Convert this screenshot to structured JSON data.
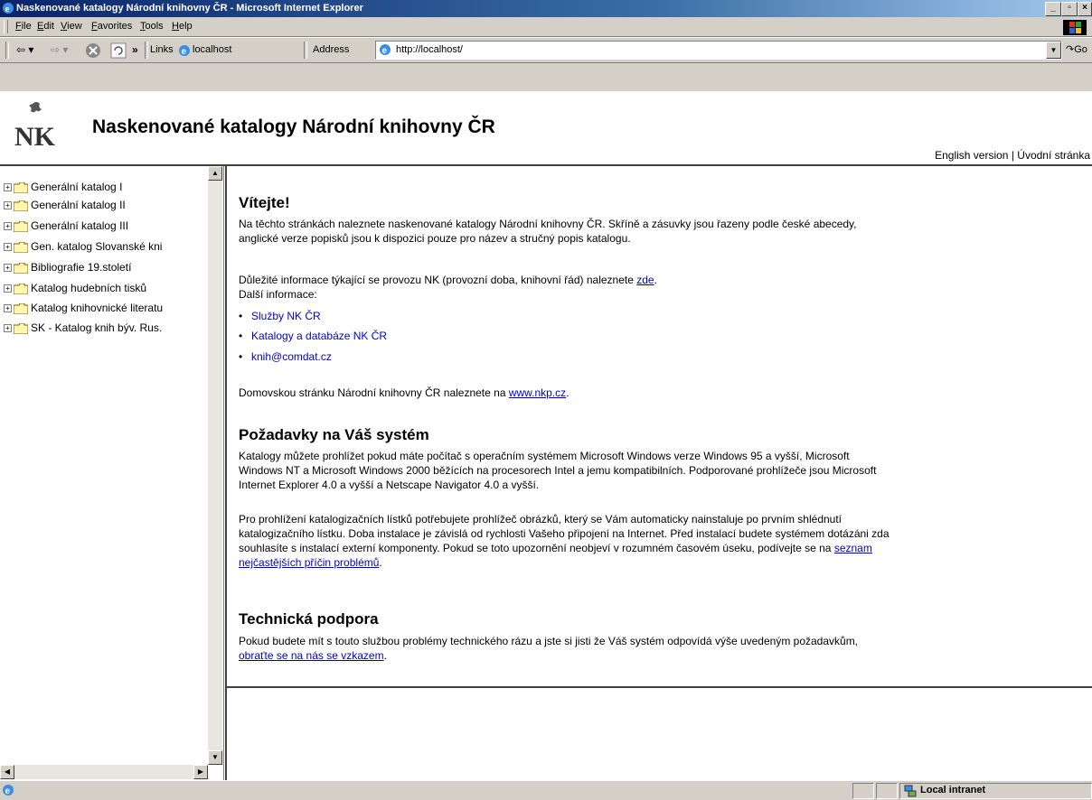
{
  "window": {
    "title": "Naskenované katalogy Národní knihovny ČR - Microsoft Internet Explorer"
  },
  "menu": [
    "File",
    "Edit",
    "View",
    "Favorites",
    "Tools",
    "Help"
  ],
  "toolbar": {
    "links_label": "Links",
    "localhost_label": "localhost",
    "address_label": "Address",
    "address_value": "http://localhost/",
    "go_label": "Go",
    "chevron": "»"
  },
  "header": {
    "title": "Naskenované katalogy Národní knihovny ČR",
    "english": "English version",
    "sep": " | ",
    "home": "Úvodní stránka"
  },
  "tree": [
    "Generální katalog I",
    "Generální katalog II",
    "Generální katalog III",
    "Gen. katalog Slovanské kni",
    "Bibliografie 19.století",
    "Katalog hudebních tisků",
    "Katalog knihovnické literatu",
    "SK - Katalog knih býv. Rus."
  ],
  "content": {
    "welcome": "Vítejte!",
    "intro_1": "Na těchto stránkách naleznete naskenované katalogy Národní knihovny ČR. Skříně a zásuvky jsou řazeny podle české abecedy,",
    "intro_2": "anglické verze popisků jsou k dispozici pouze pro název a stručný popis katalogu.",
    "info_pre": "Důležité informace týkající se provozu NK (provozní doba, knihovní řád) naleznete ",
    "info_link": "zde",
    "info_post": ".",
    "more": "Další informace:",
    "links": [
      "Služby NK ČR",
      "Katalogy a databáze NK ČR",
      "knih@comdat.cz"
    ],
    "home_pre": "Domovskou stránku Národní knihovny ČR naleznete na ",
    "home_link": "www.nkp.cz",
    "home_post": ".",
    "req_title": "Požadavky na Váš systém",
    "req_1": "Katalogy můžete prohlížet pokud máte počítač s operačním systémem Microsoft Windows verze Windows 95 a vyšší, Microsoft",
    "req_2": "Windows NT a Microsoft Windows 2000 běžících na procesorech Intel a jemu kompatibilních. Podporované prohlížeče jsou Microsoft",
    "req_3": "Internet Explorer 4.0 a vyšší a Netscape Navigator 4.0 a vyšší.",
    "view_1": "Pro prohlížení katalogizačních lístků potřebujete prohlížeč obrázků, který se Vám automaticky nainstaluje po prvním shlédnutí",
    "view_2": "katalogizačního lístku. Doba instalace je závislá od rychlosti Vašeho připojení na Internet. Před instalací budete systémem dotázáni zda",
    "view_3_pre": "souhlasíte s instalací externí komponenty. Pokud se toto upozornění neobjeví v rozumném časovém úseku, podívejte se na ",
    "view_3_link": "seznam",
    "view_4_link": "nejčastějších příčin problémů",
    "view_4_post": ".",
    "tech_title": "Technická podpora",
    "tech_1": "Pokud budete mít s touto službou problémy technického rázu a jste si jisti že Váš systém odpovídá výše uvedeným požadavkům,",
    "tech_link": "obraťte se na nás se vzkazem",
    "tech_post": "."
  },
  "status": {
    "zone": "Local intranet"
  }
}
